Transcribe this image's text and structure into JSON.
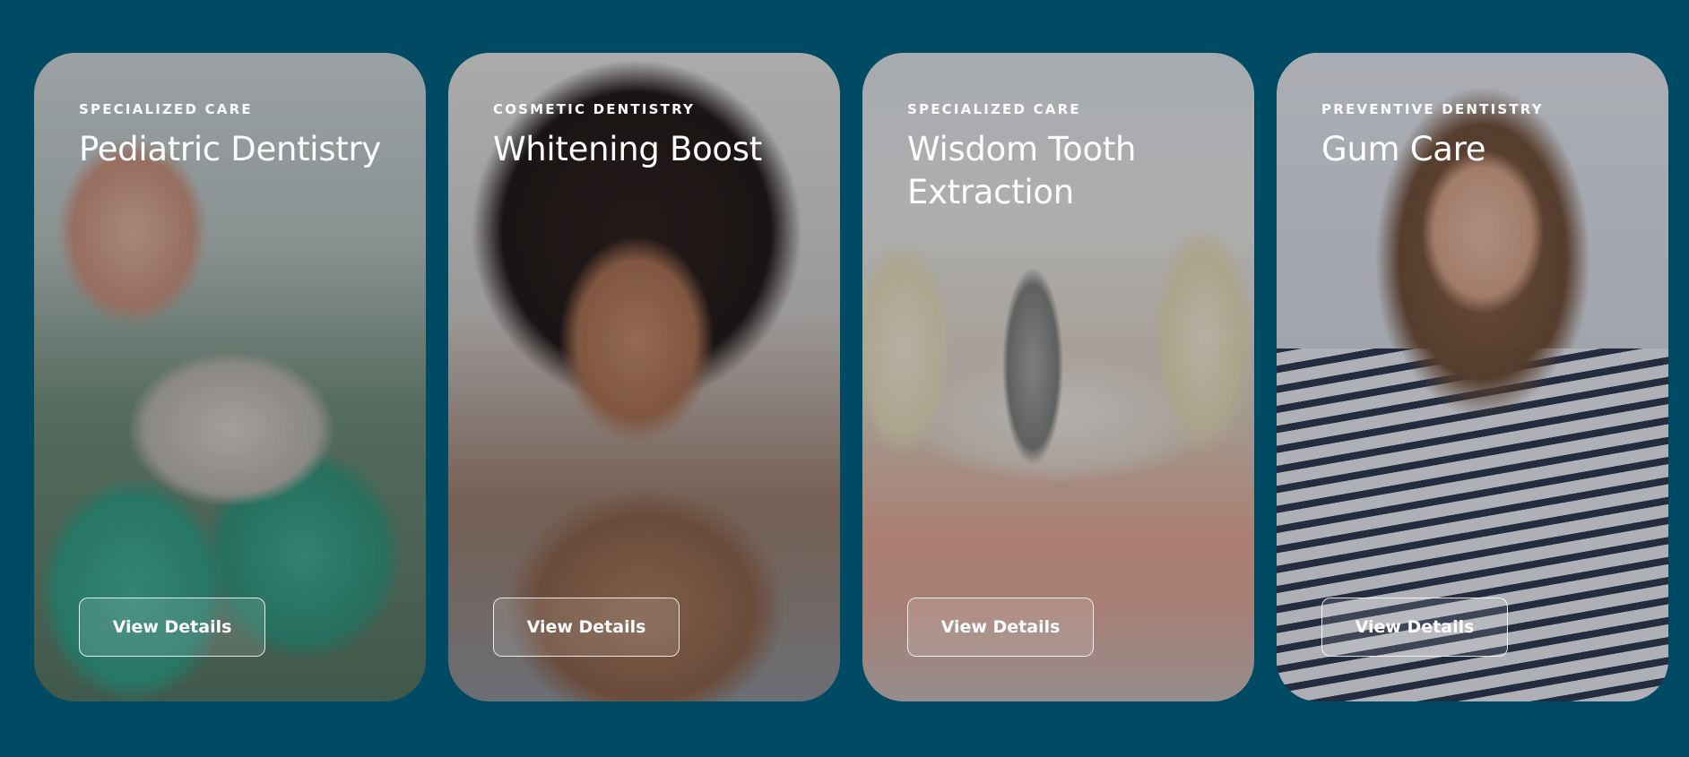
{
  "cards": [
    {
      "category": "SPECIALIZED CARE",
      "title": "Pediatric Dentistry",
      "button_label": "View Details"
    },
    {
      "category": "COSMETIC DENTISTRY",
      "title": "Whitening Boost",
      "button_label": "View Details"
    },
    {
      "category": "SPECIALIZED CARE",
      "title": "Wisdom Tooth Extraction",
      "button_label": "View Details"
    },
    {
      "category": "PREVENTIVE DENTISTRY",
      "title": "Gum Care",
      "button_label": "View Details"
    }
  ],
  "colors": {
    "page_background": "#004b63",
    "text": "#ffffff"
  }
}
